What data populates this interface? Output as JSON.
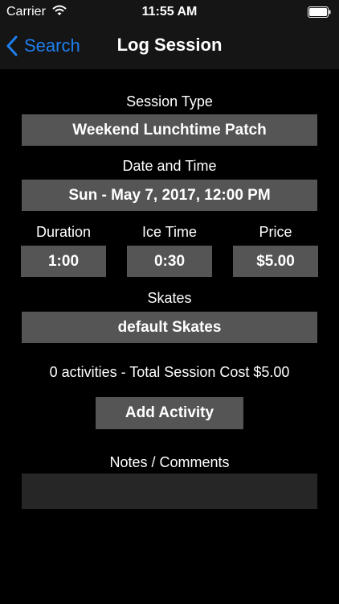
{
  "status_bar": {
    "carrier": "Carrier",
    "time": "11:55 AM",
    "wifi_icon": "wifi-icon",
    "battery_icon": "battery-icon"
  },
  "nav": {
    "back_label": "Search",
    "back_icon": "chevron-left-icon",
    "title": "Log Session",
    "accent": "#1e7ff0"
  },
  "form": {
    "session_type_label": "Session Type",
    "session_type_value": "Weekend Lunchtime Patch",
    "date_time_label": "Date and Time",
    "date_time_value": "Sun - May 7, 2017, 12:00 PM",
    "duration_label": "Duration",
    "duration_value": "1:00",
    "ice_time_label": "Ice Time",
    "ice_time_value": "0:30",
    "price_label": "Price",
    "price_value": "$5.00",
    "skates_label": "Skates",
    "skates_value": "default Skates",
    "summary": "0 activities - Total Session Cost $5.00",
    "add_activity_label": "Add Activity",
    "notes_label": "Notes / Comments",
    "notes_value": ""
  },
  "colors": {
    "background": "#000000",
    "bar_background": "#151515",
    "field_background": "#555555",
    "notes_background": "#262626"
  }
}
